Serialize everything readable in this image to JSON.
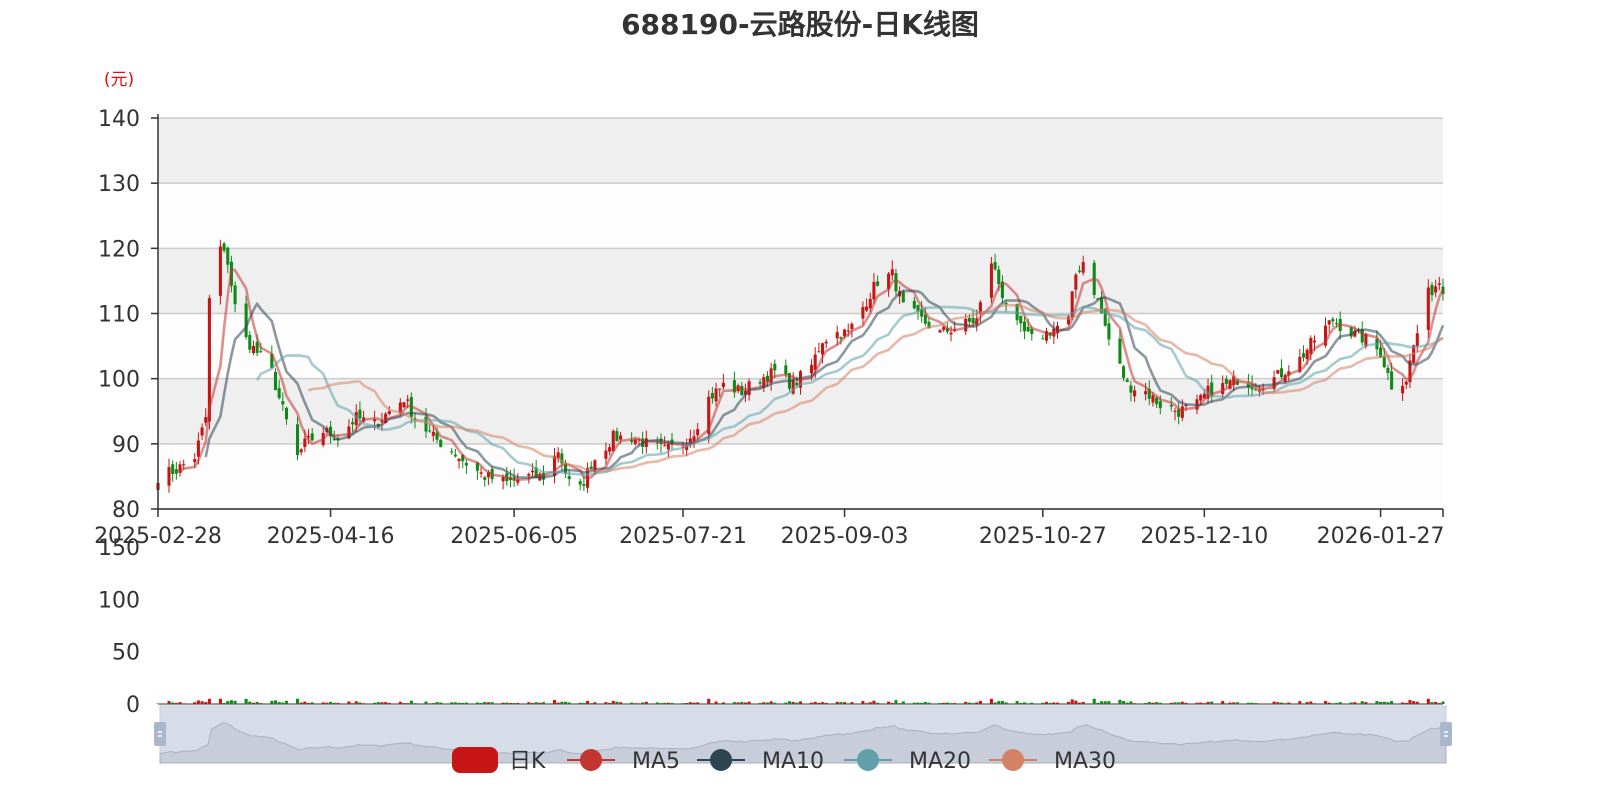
{
  "colors": {
    "up": "#c71414",
    "down": "#0f8a16",
    "ma5": "#c23531",
    "ma10": "#2f4554",
    "ma20": "#61a0a8",
    "ma30": "#d48265",
    "band": "#efefef",
    "grid": "#cccccc",
    "slider_fill": "#d7dde8",
    "slider_handle": "#a9b7cc"
  },
  "chart_data": {
    "type": "candlestick",
    "title": "688190-云路股份-日K线图",
    "price_unit": "(元)",
    "ylim": [
      80,
      140
    ],
    "yticks": [
      "80",
      "90",
      "100",
      "110",
      "120",
      "130",
      "140"
    ],
    "volume_ylim": [
      0,
      150
    ],
    "volume_yticks": [
      "0",
      "50",
      "100",
      "150"
    ],
    "xticks": [
      "2025-02-28",
      "2025-04-16",
      "2025-06-05",
      "2025-07-21",
      "2025-09-03",
      "2025-10-27",
      "2025-12-10",
      "2026-01-27"
    ],
    "date_range": [
      "2025-02-28",
      "2026-02-13"
    ],
    "close_trend": [
      [
        "2025-02-28",
        85
      ],
      [
        "2025-03-05",
        86
      ],
      [
        "2025-03-10",
        88
      ],
      [
        "2025-03-13",
        94
      ],
      [
        "2025-03-14",
        112
      ],
      [
        "2025-03-17",
        120
      ],
      [
        "2025-03-19",
        118
      ],
      [
        "2025-03-21",
        111
      ],
      [
        "2025-03-24",
        106
      ],
      [
        "2025-03-27",
        104
      ],
      [
        "2025-03-31",
        101
      ],
      [
        "2025-04-02",
        97
      ],
      [
        "2025-04-07",
        88
      ],
      [
        "2025-04-09",
        90
      ],
      [
        "2025-04-14",
        92
      ],
      [
        "2025-04-18",
        91
      ],
      [
        "2025-04-23",
        94
      ],
      [
        "2025-04-28",
        93
      ],
      [
        "2025-05-06",
        97
      ],
      [
        "2025-05-09",
        94
      ],
      [
        "2025-05-14",
        91
      ],
      [
        "2025-05-19",
        89
      ],
      [
        "2025-05-23",
        87
      ],
      [
        "2025-05-28",
        85
      ],
      [
        "2025-06-03",
        84
      ],
      [
        "2025-06-09",
        85
      ],
      [
        "2025-06-13",
        85
      ],
      [
        "2025-06-17",
        89
      ],
      [
        "2025-06-20",
        84
      ],
      [
        "2025-06-23",
        83
      ],
      [
        "2025-06-26",
        87
      ],
      [
        "2025-07-02",
        91
      ],
      [
        "2025-07-07",
        91
      ],
      [
        "2025-07-11",
        90
      ],
      [
        "2025-07-16",
        89
      ],
      [
        "2025-07-21",
        90
      ],
      [
        "2025-07-24",
        92
      ],
      [
        "2025-07-28",
        97
      ],
      [
        "2025-08-01",
        99
      ],
      [
        "2025-08-06",
        98
      ],
      [
        "2025-08-11",
        100
      ],
      [
        "2025-08-15",
        101
      ],
      [
        "2025-08-20",
        99
      ],
      [
        "2025-08-25",
        102
      ],
      [
        "2025-08-28",
        106
      ],
      [
        "2025-09-01",
        107
      ],
      [
        "2025-09-04",
        107
      ],
      [
        "2025-09-09",
        112
      ],
      [
        "2025-09-12",
        115
      ],
      [
        "2025-09-16",
        116
      ],
      [
        "2025-09-19",
        111
      ],
      [
        "2025-09-24",
        109
      ],
      [
        "2025-09-29",
        107
      ],
      [
        "2025-10-09",
        109
      ],
      [
        "2025-10-13",
        118
      ],
      [
        "2025-10-16",
        113
      ],
      [
        "2025-10-20",
        108
      ],
      [
        "2025-10-24",
        106
      ],
      [
        "2025-10-28",
        107
      ],
      [
        "2025-11-03",
        109
      ],
      [
        "2025-11-05",
        116
      ],
      [
        "2025-11-07",
        118
      ],
      [
        "2025-11-11",
        112
      ],
      [
        "2025-11-14",
        106
      ],
      [
        "2025-11-19",
        99
      ],
      [
        "2025-11-24",
        98
      ],
      [
        "2025-11-28",
        96
      ],
      [
        "2025-12-03",
        95
      ],
      [
        "2025-12-08",
        96
      ],
      [
        "2025-12-11",
        98
      ],
      [
        "2025-12-16",
        99
      ],
      [
        "2025-12-19",
        100
      ],
      [
        "2025-12-24",
        99
      ],
      [
        "2025-12-29",
        100
      ],
      [
        "2026-01-05",
        103
      ],
      [
        "2026-01-09",
        106
      ],
      [
        "2026-01-14",
        109
      ],
      [
        "2026-01-19",
        107
      ],
      [
        "2026-01-23",
        106
      ],
      [
        "2026-01-27",
        104
      ],
      [
        "2026-01-30",
        99
      ],
      [
        "2026-02-03",
        100
      ],
      [
        "2026-02-05",
        105
      ],
      [
        "2026-02-09",
        113
      ],
      [
        "2026-02-12",
        115
      ],
      [
        "2026-02-13",
        114
      ]
    ],
    "series": [
      {
        "name": "日K",
        "kind": "candlestick"
      },
      {
        "name": "MA5",
        "kind": "line"
      },
      {
        "name": "MA10",
        "kind": "line"
      },
      {
        "name": "MA20",
        "kind": "line"
      },
      {
        "name": "MA30",
        "kind": "line"
      }
    ],
    "volume_peak": 5,
    "volume_typical": 1,
    "legend_placement": "bottom-center",
    "grid": true,
    "datazoom": {
      "start_percent": 0,
      "end_percent": 100
    }
  }
}
